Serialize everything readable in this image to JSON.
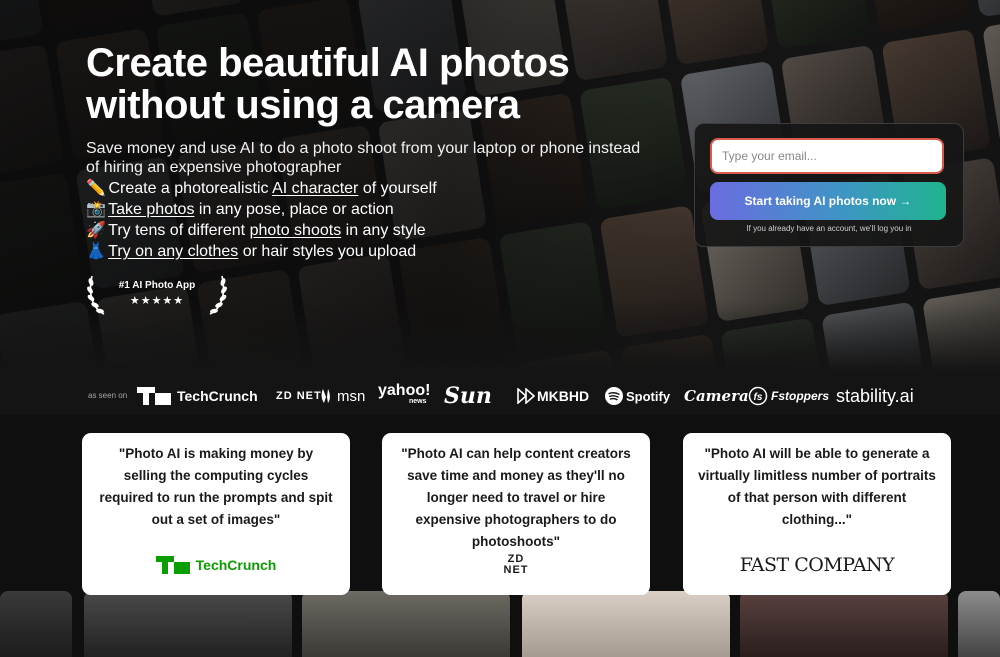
{
  "hero": {
    "headline": "Create beautiful AI photos without using a camera",
    "subtitle": "Save money and use AI to do a photo shoot from your laptop or phone instead of hiring an expensive photographer",
    "features": [
      {
        "emoji": "✏️",
        "pre": "Create a photorealistic ",
        "link": "AI character",
        "post": " of yourself"
      },
      {
        "emoji": "📸",
        "pre": "",
        "link": "Take photos",
        "post": " in any pose, place or action"
      },
      {
        "emoji": "🚀",
        "pre": "Try tens of different ",
        "link": "photo shoots",
        "post": " in any style"
      },
      {
        "emoji": "👗",
        "pre": "",
        "link": "Try on any clothes",
        "post": " or hair styles you upload"
      }
    ],
    "badge": {
      "title": "#1 AI Photo App",
      "stars": "★★★★★"
    }
  },
  "signup": {
    "email_placeholder": "Type your email...",
    "cta_label": "Start taking AI photos now →",
    "note": "If you already have an account, we'll log you in"
  },
  "seen_on": {
    "label": "as seen on",
    "logos": {
      "techcrunch": "TechCrunch",
      "zdnet": "ZD NET",
      "msn": "msn",
      "yahoo": "yahoo!",
      "yahoo_sub": "news",
      "sun": "Sun",
      "mkbhd": "MKBHD",
      "spotify": "Spotify",
      "digital_camera": "Camera",
      "fstoppers": "Fstoppers",
      "stability": "stability.ai"
    }
  },
  "testimonials": [
    {
      "quote": "\"Photo AI is making money by selling the computing cycles required to run the prompts and spit out a set of images\"",
      "source": "TechCrunch"
    },
    {
      "quote": "\"Photo AI can help content creators save time and money as they'll no longer need to travel or hire expensive photographers to do photoshoots\"",
      "source": "ZD NET"
    },
    {
      "quote": "\"Photo AI will be able to generate a virtually limitless number of portraits of that person with different clothing...\"",
      "source": "FAST COMPANY"
    }
  ],
  "colors": {
    "accent_input_border": "#d95b4b",
    "cta_gradient_start": "#6b6ce0",
    "cta_gradient_end": "#1fb48e",
    "techcrunch_green": "#0a9e01"
  }
}
